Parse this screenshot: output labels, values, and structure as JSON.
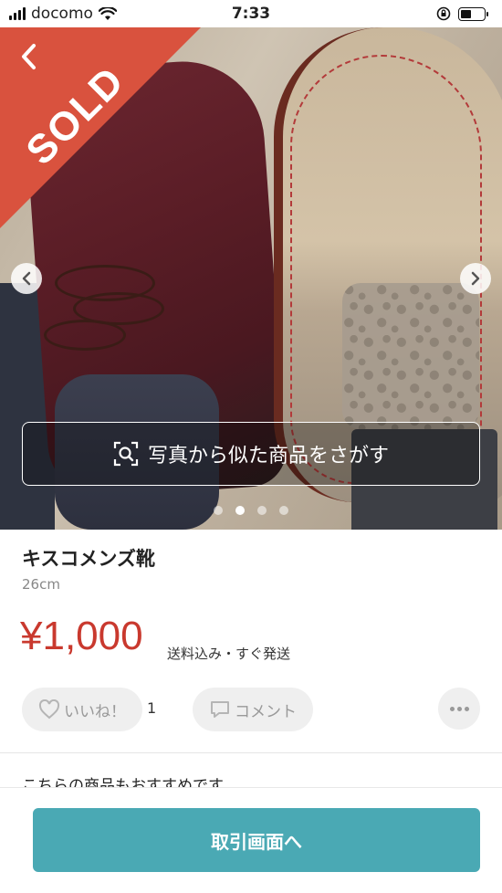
{
  "status_bar": {
    "carrier": "docomo",
    "time": "7:33"
  },
  "item": {
    "sold_label": "SOLD",
    "search_similar_label": "写真から似た商品をさがす",
    "photo_count": 4,
    "active_photo_index": 1,
    "title": "キスコメンズ靴",
    "size": "26cm",
    "price": "¥1,000",
    "shipping_note": "送料込み・すぐ発送"
  },
  "actions": {
    "like_label": "いいね！",
    "like_count": "1",
    "comment_label": "コメント"
  },
  "recommend": {
    "heading": "こちらの商品もおすすめです"
  },
  "bottom": {
    "cta_label": "取引画面へ"
  },
  "colors": {
    "sold_band": "#d9523e",
    "price": "#c9392e",
    "cta": "#4aa9b4"
  }
}
